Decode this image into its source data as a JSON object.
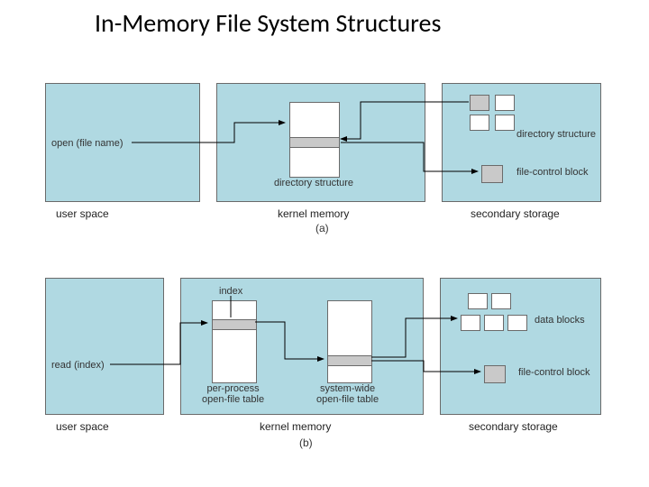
{
  "title": "In-Memory File System Structures",
  "diagram_a": {
    "figure_label": "(a)",
    "user_space": {
      "region": "user space",
      "call": "open (file name)"
    },
    "kernel_memory": {
      "region": "kernel memory",
      "table1": "directory structure"
    },
    "secondary_storage": {
      "region": "secondary storage",
      "labels": {
        "dir_structure": "directory structure",
        "fcb": "file-control block"
      }
    }
  },
  "diagram_b": {
    "figure_label": "(b)",
    "user_space": {
      "region": "user space",
      "call": "read (index)"
    },
    "kernel_memory": {
      "region": "kernel memory",
      "index_label": "index",
      "table1": "per-process\nopen-file table",
      "table2": "system-wide\nopen-file table"
    },
    "secondary_storage": {
      "region": "secondary storage",
      "labels": {
        "data_blocks": "data blocks",
        "fcb": "file-control block"
      }
    }
  }
}
